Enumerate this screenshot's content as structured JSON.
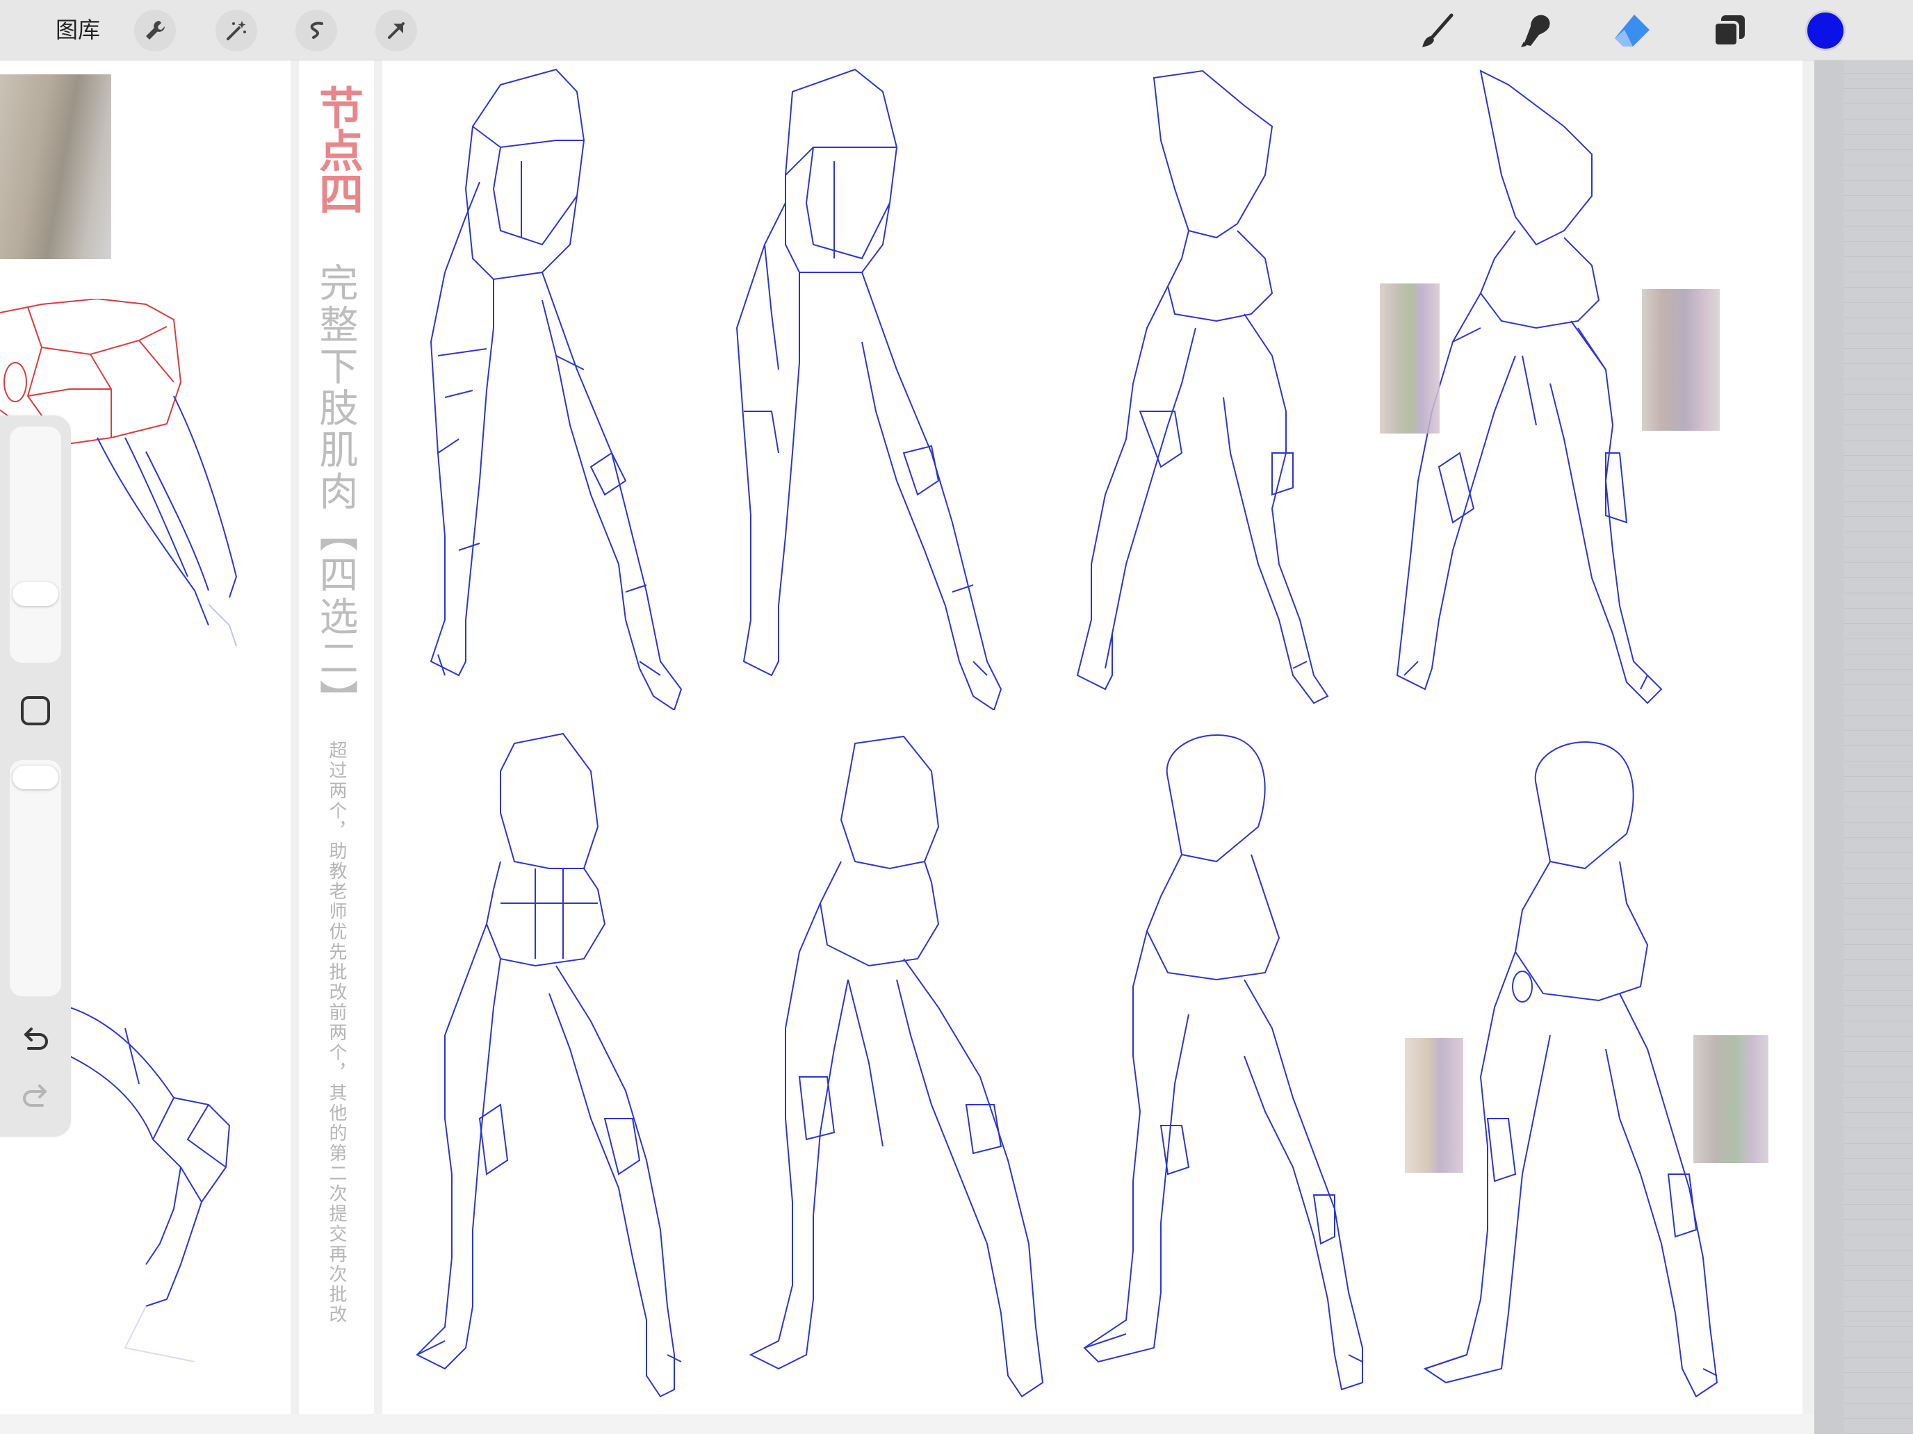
{
  "toolbar": {
    "gallery_label": "图库",
    "left_tools": [
      "wrench-icon",
      "magic-wand-icon",
      "selection-icon",
      "transform-arrow-icon"
    ],
    "right_tools": [
      "brush-icon",
      "smudge-icon",
      "eraser-icon",
      "layers-icon"
    ],
    "active_tool": "eraser",
    "active_tool_color": "#3a8ef0",
    "current_color": "#0a12e8"
  },
  "canvas": {
    "title_red": "节点四",
    "title_gray": "完整下肢肌肉【四选二】",
    "note": "超过两个，助教老师优先批改前两个，其他的第二次提交再次批改",
    "title_red_color": "#e8868a",
    "sketch_stroke_color": "#2b35d8",
    "highlight_stroke_color": "#e03a3a"
  },
  "sidebar": {
    "brush_size_level": 0.1,
    "opacity_level": 0.0,
    "modify_button": "square-icon",
    "undo": "undo-icon",
    "redo": "redo-icon"
  }
}
